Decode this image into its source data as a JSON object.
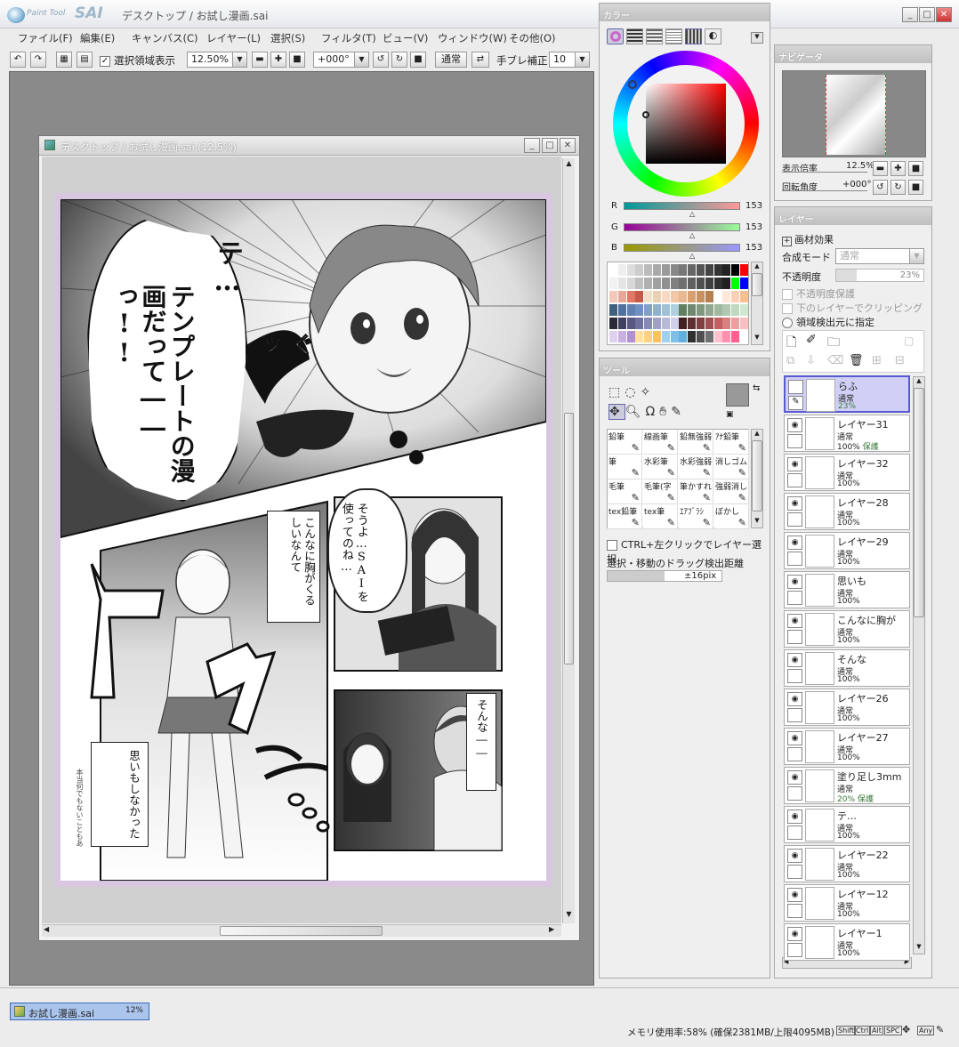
{
  "app": {
    "logo_small": "Paint Tool",
    "logo_big": "SAI",
    "title": "デスクトップ / お試し漫画.sai"
  },
  "menu": [
    "ファイル(F)",
    "編集(E)",
    "キャンバス(C)",
    "レイヤー(L)",
    "選択(S)",
    "フィルタ(T)",
    "ビュー(V)",
    "ウィンドウ(W)",
    "その他(O)"
  ],
  "toolbar": {
    "selection_label": "選択領域表示",
    "selection_checked": true,
    "zoom": "12.50%",
    "rotation": "+000°",
    "blend": "通常",
    "stab_label": "手ブレ補正",
    "stab_value": "10"
  },
  "document": {
    "title": "デスクトップ / お試し漫画.sai (12.5%)"
  },
  "manga": {
    "shout_top": "テ…",
    "shout_main": "テンプレートの漫画だって――っ!!",
    "sfx_gu": "ぐッ",
    "sfx_to": "ト",
    "sfx_ku": "ク",
    "sfx_n": "ン",
    "box1": "こんなに胸がくるしいなんて",
    "bubble2": "そうよ…SAIを使ってのね…",
    "box3": "そんな――",
    "box4": "思いもしなかった",
    "handwritten": "本当何でもないこともあ"
  },
  "color_panel": {
    "title": "カラー",
    "r_label": "R",
    "r": "153",
    "g_label": "G",
    "g": "153",
    "b_label": "B",
    "b": "153",
    "current_color": "#999999",
    "wheel_marker": "#a7d0dc"
  },
  "swatches": [
    "#ffffff",
    "#eeeeee",
    "#dddddd",
    "#cccccc",
    "#bbbbbb",
    "#aaaaaa",
    "#999999",
    "#888888",
    "#777777",
    "#666666",
    "#555555",
    "#444444",
    "#333333",
    "#222222",
    "#000000",
    "#ff0000",
    "#f2f2f2",
    "#e5e5e5",
    "#d8d8d8",
    "#c0c0c0",
    "#b0b0b0",
    "#a0a0a0",
    "#909090",
    "#808080",
    "#707070",
    "#606060",
    "#505050",
    "#404040",
    "#303030",
    "#202020",
    "#00ff00",
    "#0000ff",
    "#f4c8b8",
    "#e8a898",
    "#e07868",
    "#c85848",
    "#f0e0c8",
    "#e8d0b0",
    "#f8d8c0",
    "#f0c8a8",
    "#e8b890",
    "#d8a070",
    "#c89060",
    "#b88050",
    "#ffffff",
    "#ffe8d8",
    "#ffd0b8",
    "#f8c090",
    "#406080",
    "#5070a0",
    "#6080b0",
    "#7090c0",
    "#80a0c8",
    "#90b0d0",
    "#a0c0d8",
    "#b0d0e0",
    "#608060",
    "#708870",
    "#809880",
    "#90a890",
    "#a0b8a0",
    "#b0c8b0",
    "#c0d8c0",
    "#d0e8d0",
    "#2a2a3a",
    "#404060",
    "#585880",
    "#7070a0",
    "#8888b8",
    "#a0a0c8",
    "#b8b8d8",
    "#d0d0e8",
    "#402020",
    "#603030",
    "#804040",
    "#a05050",
    "#c06060",
    "#d88080",
    "#e8a0a0",
    "#f8c0c0",
    "#e0d0f0",
    "#c8b0e0",
    "#b090d0",
    "#ffe0a0",
    "#ffd080",
    "#ffc060",
    "#a0d0f0",
    "#80c0e8",
    "#60b0e0",
    "#303030",
    "#505050",
    "#707070",
    "#ffc0d0",
    "#ff90b0",
    "#ff6090",
    "#ffffff"
  ],
  "navigator": {
    "title": "ナビゲータ",
    "zoom_label": "表示倍率",
    "zoom": "12.5%",
    "rot_label": "回転角度",
    "rot": "+000°"
  },
  "tool_panel": {
    "title": "ツール",
    "main_color": "#999999",
    "sub_color": "#ffffff",
    "brushes": [
      "鉛筆",
      "線画筆",
      "鉛無強弱",
      "ｱﾅ鉛筆",
      "筆",
      "水彩筆",
      "水彩強弱",
      "消しゴム",
      "毛筆",
      "毛筆(字",
      "筆かすれ",
      "強弱消し",
      "tex鉛筆",
      "tex筆",
      "ｴｱﾌﾞﾗｼ",
      "ぼかし"
    ],
    "ctrl_select": "CTRL+左クリックでレイヤー選択",
    "drag_label": "選択・移動のドラッグ検出距離",
    "drag_value": "±16pix"
  },
  "layer_panel": {
    "title": "レイヤー",
    "effect": "画材効果",
    "blend_label": "合成モード",
    "blend_value": "通常",
    "opacity_label": "不透明度",
    "opacity_value": "23%",
    "preserve_opacity": "不透明度保護",
    "clip": "下のレイヤーでクリッピング",
    "source": "領域検出元に指定",
    "layers": [
      {
        "name": "らふ",
        "mode": "通常",
        "opacity": "23%",
        "extra": "",
        "selected": true
      },
      {
        "name": "レイヤー31",
        "mode": "通常",
        "opacity": "100%",
        "extra": "保護",
        "selected": false
      },
      {
        "name": "レイヤー32",
        "mode": "通常",
        "opacity": "100%",
        "extra": "",
        "selected": false
      },
      {
        "name": "レイヤー28",
        "mode": "通常",
        "opacity": "100%",
        "extra": "",
        "selected": false
      },
      {
        "name": "レイヤー29",
        "mode": "通常",
        "opacity": "100%",
        "extra": "",
        "selected": false
      },
      {
        "name": "思いも",
        "mode": "通常",
        "opacity": "100%",
        "extra": "",
        "selected": false
      },
      {
        "name": "こんなに胸が",
        "mode": "通常",
        "opacity": "100%",
        "extra": "",
        "selected": false
      },
      {
        "name": "そんな",
        "mode": "通常",
        "opacity": "100%",
        "extra": "",
        "selected": false
      },
      {
        "name": "レイヤー26",
        "mode": "通常",
        "opacity": "100%",
        "extra": "",
        "selected": false
      },
      {
        "name": "レイヤー27",
        "mode": "通常",
        "opacity": "100%",
        "extra": "",
        "selected": false
      },
      {
        "name": "塗り足し3mm",
        "mode": "通常",
        "opacity": "20%",
        "extra": "保護",
        "selected": false
      },
      {
        "name": "テ…",
        "mode": "通常",
        "opacity": "100%",
        "extra": "",
        "selected": false
      },
      {
        "name": "レイヤー22",
        "mode": "通常",
        "opacity": "100%",
        "extra": "",
        "selected": false
      },
      {
        "name": "レイヤー12",
        "mode": "通常",
        "opacity": "100%",
        "extra": "",
        "selected": false
      },
      {
        "name": "レイヤー1",
        "mode": "通常",
        "opacity": "100%",
        "extra": "",
        "selected": false
      }
    ]
  },
  "taskbar": {
    "doc": "お試し漫画.sai",
    "doc_zoom": "12%",
    "memory": "メモリ使用率:58% (確保2381MB/上限4095MB)",
    "keys": [
      "Shift",
      "Ctrl",
      "Alt",
      "SPC",
      "Any"
    ]
  }
}
